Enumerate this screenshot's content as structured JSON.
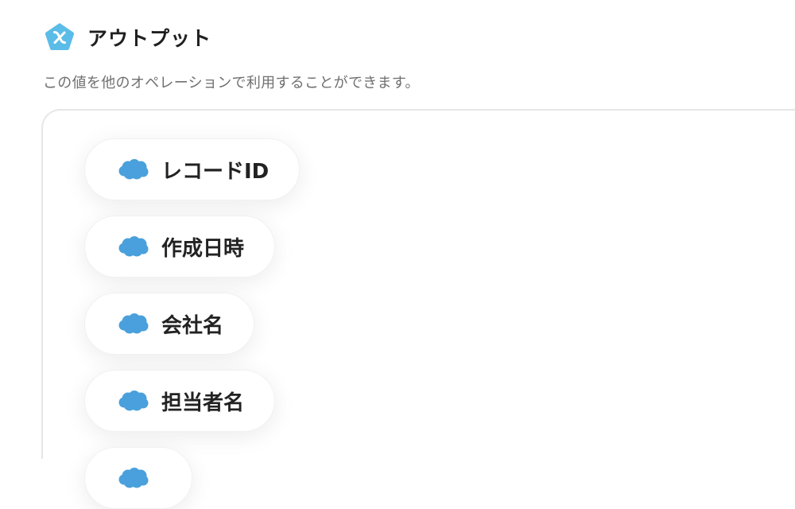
{
  "header": {
    "title": "アウトプット",
    "icon": "yoom-pentagon-icon",
    "icon_color": "#5bbce8"
  },
  "description": "この値を他のオペレーションで利用することができます。",
  "outputs": [
    {
      "label": "レコードID",
      "icon": "salesforce-cloud-icon"
    },
    {
      "label": "作成日時",
      "icon": "salesforce-cloud-icon"
    },
    {
      "label": "会社名",
      "icon": "salesforce-cloud-icon"
    },
    {
      "label": "担当者名",
      "icon": "salesforce-cloud-icon"
    },
    {
      "label": "",
      "icon": "salesforce-cloud-icon"
    }
  ],
  "colors": {
    "salesforce_blue": "#4aa0dc",
    "accent_icon": "#5bbce8",
    "text_dark": "#222222",
    "text_muted": "#6f6f6f",
    "panel_border": "#e6e6e6"
  }
}
